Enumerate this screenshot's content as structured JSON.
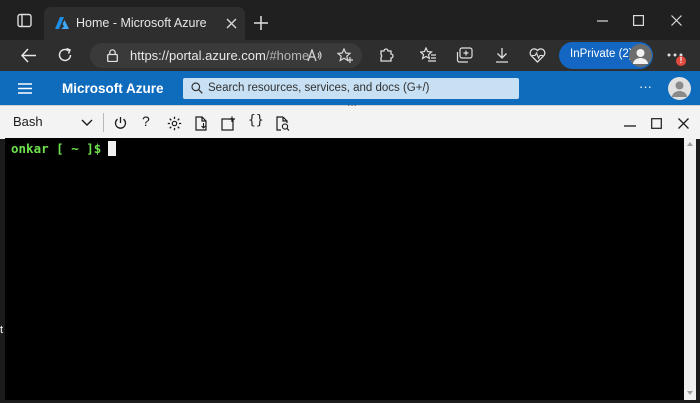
{
  "browser": {
    "tab_title": "Home - Microsoft Azure",
    "url_host": "https://portal.azure.com",
    "url_path": "/#home",
    "inprivate_label": "InPrivate (2)",
    "notification_badge": "!"
  },
  "azure": {
    "brand": "Microsoft Azure",
    "search_placeholder": "Search resources, services, and docs (G+/)",
    "more_label": "···",
    "splitter_label": "···"
  },
  "cloudshell": {
    "shell_type": "Bash",
    "prompt": "onkar [ ~ ]$"
  },
  "edge_text": "t",
  "colors": {
    "azure_blue": "#0f6cbd",
    "terminal_bg": "#000000",
    "prompt_green": "#6ee24c",
    "inprivate_blue": "#1367c2"
  }
}
